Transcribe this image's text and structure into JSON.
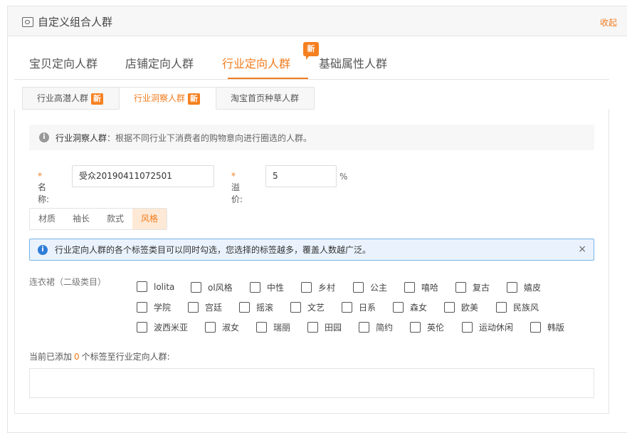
{
  "panel": {
    "title": "自定义组合人群",
    "collapse_label": "收起",
    "icon": "image-icon"
  },
  "main_tabs": [
    {
      "label": "宝贝定向人群"
    },
    {
      "label": "店铺定向人群"
    },
    {
      "label": "行业定向人群",
      "badge": "新"
    },
    {
      "label": "基础属性人群"
    }
  ],
  "sub_tabs": [
    {
      "label": "行业高潜人群",
      "badge": "新"
    },
    {
      "label": "行业洞察人群",
      "badge": "新"
    },
    {
      "label": "淘宝首页种草人群"
    }
  ],
  "info": {
    "title": "行业洞察人群",
    "text": "：根据不同行业下消费者的购物意向进行圈选的人群。"
  },
  "form": {
    "name_label": "名称:",
    "name_value": "受众20190411072501",
    "premium_label": "溢价:",
    "premium_value": "5",
    "premium_unit": "%"
  },
  "segments": [
    "材质",
    "袖长",
    "款式",
    "风格"
  ],
  "alert": {
    "text": "行业定向人群的各个标签类目可以同时勾选，您选择的标签越多，覆盖人数越广泛。",
    "close": "×"
  },
  "category": {
    "label": "连衣裙（二级类目）",
    "rows": [
      [
        "lolita",
        "ol风格",
        "中性",
        "乡村",
        "公主",
        "嘻哈",
        "复古",
        "嬉皮"
      ],
      [
        "学院",
        "宫廷",
        "摇滚",
        "文艺",
        "日系",
        "森女",
        "欧美",
        "民族风"
      ],
      [
        "波西米亚",
        "淑女",
        "瑞丽",
        "田园",
        "简约",
        "英伦",
        "运动休闲",
        "韩版"
      ]
    ]
  },
  "added": {
    "prefix": "当前已添加",
    "count": "0",
    "suffix": "个标签至行业定向人群:"
  },
  "colors": {
    "accent": "#f27c1e",
    "alert_bg": "#eaf3fd",
    "alert_border": "#7ab2ea"
  }
}
